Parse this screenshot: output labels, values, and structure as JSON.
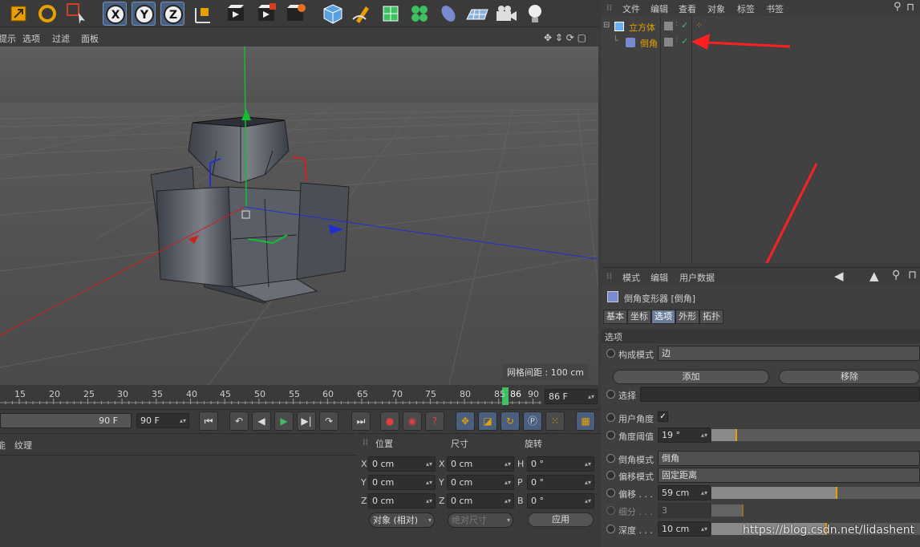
{
  "toolbar": {
    "icons": [
      "scale-icon",
      "rotate-icon",
      "select-arrow-icon",
      "x-axis-icon",
      "y-axis-icon",
      "z-axis-icon",
      "coordinate-system-icon",
      "render-view-icon",
      "render-picture-icon",
      "render-settings-icon",
      "cube-icon",
      "pen-icon",
      "subdivision-icon",
      "cloner-icon",
      "deformer-icon",
      "floor-icon",
      "camera-icon",
      "light-icon"
    ]
  },
  "viewport": {
    "menu": [
      "提示",
      "选项",
      "过滤",
      "面板"
    ],
    "grid_label": "网格间距 : 100 cm"
  },
  "timeline": {
    "ticks": [
      "15",
      "20",
      "25",
      "30",
      "35",
      "40",
      "45",
      "50",
      "55",
      "60",
      "65",
      "70",
      "75",
      "80",
      "85",
      "86",
      "90"
    ],
    "current_frame": "86 F"
  },
  "transport": {
    "start_field": "90 F",
    "end_field": "90 F"
  },
  "material": {
    "tabs": [
      "能",
      "纹理"
    ]
  },
  "coords": {
    "headers": [
      "位置",
      "尺寸",
      "旋转"
    ],
    "pos": [
      {
        "axis": "X",
        "value": "0 cm"
      },
      {
        "axis": "Y",
        "value": "0 cm"
      },
      {
        "axis": "Z",
        "value": "0 cm"
      }
    ],
    "size": [
      {
        "axis": "X",
        "value": "0 cm"
      },
      {
        "axis": "Y",
        "value": "0 cm"
      },
      {
        "axis": "Z",
        "value": "0 cm"
      }
    ],
    "rot": [
      {
        "axis": "H",
        "value": "0 °"
      },
      {
        "axis": "P",
        "value": "0 °"
      },
      {
        "axis": "B",
        "value": "0 °"
      }
    ],
    "mode_select": "对象 (相对)",
    "size_select": "绝对尺寸",
    "apply": "应用"
  },
  "object_manager": {
    "menu": [
      "文件",
      "编辑",
      "查看",
      "对象",
      "标签",
      "书签"
    ],
    "objects": [
      {
        "name": "立方体",
        "color": "#e8a000"
      },
      {
        "name": "倒角",
        "color": "#e8a000"
      }
    ]
  },
  "attributes": {
    "menu": [
      "模式",
      "编辑",
      "用户数据"
    ],
    "title": "倒角变形器 [倒角]",
    "tabs": [
      "基本",
      "坐标",
      "选项",
      "外形",
      "拓扑"
    ],
    "active_tab": "选项",
    "section": "选项",
    "construction_mode": {
      "label": "构成模式",
      "value": "边"
    },
    "add_button": "添加",
    "remove_button": "移除",
    "selection": {
      "label": "选择",
      "value": ""
    },
    "user_angle": {
      "label": "用户角度",
      "checked": "✓"
    },
    "angle_threshold": {
      "label": "角度阈值",
      "value": "19 °",
      "level": 0.12
    },
    "bevel_mode": {
      "label": "倒角模式",
      "value": "倒角"
    },
    "offset_mode": {
      "label": "偏移模式",
      "value": "固定距离"
    },
    "offset": {
      "label": "偏移 . . .",
      "value": "59 cm",
      "level": 0.6
    },
    "subdivision": {
      "label": "细分 . . .",
      "value": "3",
      "level": 0.15
    },
    "depth": {
      "label": "深度 . . .",
      "value": "10 cm",
      "level": 0.55
    }
  },
  "watermark": "https://blog.csdn.net/lidashent"
}
